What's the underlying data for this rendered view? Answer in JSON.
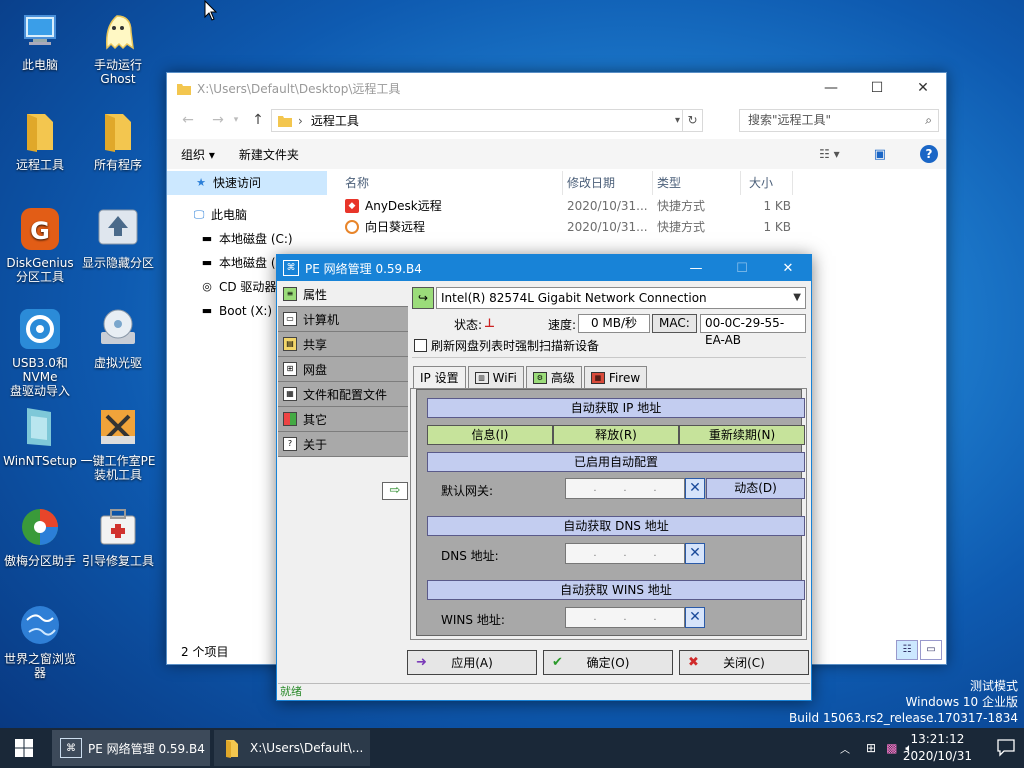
{
  "desktop": {
    "icons": [
      {
        "label": "此电脑",
        "icon": "this-pc-icon"
      },
      {
        "label": "手动运行\nGhost",
        "icon": "ghost-icon"
      },
      {
        "label": "远程工具",
        "icon": "folder-icon"
      },
      {
        "label": "所有程序",
        "icon": "folder-icon"
      },
      {
        "label": "DiskGenius\n分区工具",
        "icon": "diskgenius-icon"
      },
      {
        "label": "显示隐藏分区",
        "icon": "show-partition-icon"
      },
      {
        "label": "USB3.0和NVMe\n盘驱动导入",
        "icon": "usb-driver-icon"
      },
      {
        "label": "虚拟光驱",
        "icon": "virtual-drive-icon"
      },
      {
        "label": "WinNTSetup",
        "icon": "winntsetup-icon"
      },
      {
        "label": "一键工作室PE\n装机工具",
        "icon": "pe-install-icon"
      },
      {
        "label": "傲梅分区助手",
        "icon": "aomei-icon"
      },
      {
        "label": "引导修复工具",
        "icon": "boot-repair-icon"
      },
      {
        "label": "世界之窗浏览\n器",
        "icon": "browser-icon"
      }
    ]
  },
  "explorer": {
    "title": "X:\\Users\\Default\\Desktop\\远程工具",
    "address": "远程工具",
    "search_placeholder": "搜索\"远程工具\"",
    "toolbar": {
      "organize": "组织 ▾",
      "new_folder": "新建文件夹"
    },
    "nav": {
      "quick_access": "快速访问",
      "this_pc": "此电脑",
      "drives": [
        "本地磁盘 (C:)",
        "本地磁盘 (",
        "CD 驱动器",
        "Boot (X:)"
      ]
    },
    "columns": {
      "name": "名称",
      "date": "修改日期",
      "type": "类型",
      "size": "大小"
    },
    "files": [
      {
        "name": "AnyDesk远程",
        "date": "2020/10/31...",
        "type": "快捷方式",
        "size": "1 KB",
        "icon": "anydesk-icon"
      },
      {
        "name": "向日葵远程",
        "date": "2020/10/31...",
        "type": "快捷方式",
        "size": "1 KB",
        "icon": "sunflower-icon"
      }
    ],
    "status": "2 个项目"
  },
  "pe": {
    "title": "PE 网络管理 0.59.B4",
    "sidebar": [
      "属性",
      "计算机",
      "共享",
      "网盘",
      "文件和配置文件",
      "其它",
      "关于"
    ],
    "adapter": "Intel(R) 82574L Gigabit Network Connection",
    "status_label": "状态:",
    "speed_label": "速度:",
    "speed_value": "0 MB/秒",
    "mac_label": "MAC:",
    "mac_value": "00-0C-29-55-EA-AB",
    "refresh_checkbox": "刷新网盘列表时强制扫描新设备",
    "tabs": [
      "IP 设置",
      "WiFi",
      "高级",
      "Firew"
    ],
    "ip_auto": "自动获取 IP 地址",
    "btn_info": "信息(I)",
    "btn_release": "释放(R)",
    "btn_renew": "重新续期(N)",
    "auto_config": "已启用自动配置",
    "gateway_label": "默认网关:",
    "dynamic_btn": "动态(D)",
    "dns_auto": "自动获取 DNS 地址",
    "dns_label": "DNS 地址:",
    "wins_auto": "自动获取 WINS 地址",
    "wins_label": "WINS 地址:",
    "apply": "应用(A)",
    "ok": "确定(O)",
    "close": "关闭(C)",
    "status": "就绪"
  },
  "watermark": {
    "line1": "测试模式",
    "line2": "Windows 10 企业版",
    "line3": "Build 15063.rs2_release.170317-1834"
  },
  "taskbar": {
    "tasks": [
      "PE 网络管理 0.59.B4",
      "X:\\Users\\Default\\..."
    ],
    "time": "13:21:12",
    "date": "2020/10/31"
  },
  "colors": {
    "accent": "#1883d7",
    "taskbar": "#1a2838",
    "side_selected": "#f0f0f0",
    "green_button": "#c6e39b",
    "blue_bar": "#c3cdf0"
  }
}
